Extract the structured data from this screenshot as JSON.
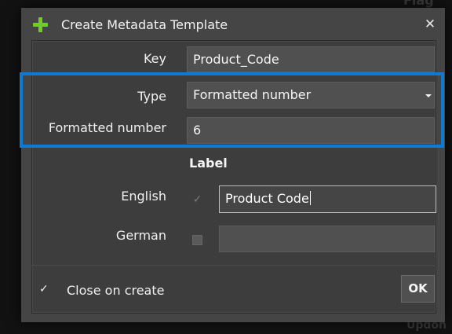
{
  "background": {
    "top_partial_text": "Flag",
    "bottom_partial_text": "Updon"
  },
  "dialog": {
    "title": "Create Metadata Template",
    "title_icon": "plus-icon",
    "close_icon": "close-icon",
    "close_glyph": "✕"
  },
  "form": {
    "key": {
      "label": "Key",
      "value": "Product_Code"
    },
    "type": {
      "label": "Type",
      "value": "Formatted number"
    },
    "formatted_number": {
      "label": "Formatted number",
      "value": "6"
    }
  },
  "labels_section": {
    "heading": "Label",
    "rows": [
      {
        "language": "English",
        "checked": true,
        "value": "Product Code"
      },
      {
        "language": "German",
        "checked": false,
        "value": ""
      }
    ]
  },
  "footer": {
    "close_on_create": {
      "label": "Close on create",
      "checked": true
    },
    "ok_label": "OK"
  },
  "colors": {
    "accent_highlight": "#0d7bd3",
    "plus_icon": "#6fcf1c",
    "dialog_bg": "#454545"
  }
}
